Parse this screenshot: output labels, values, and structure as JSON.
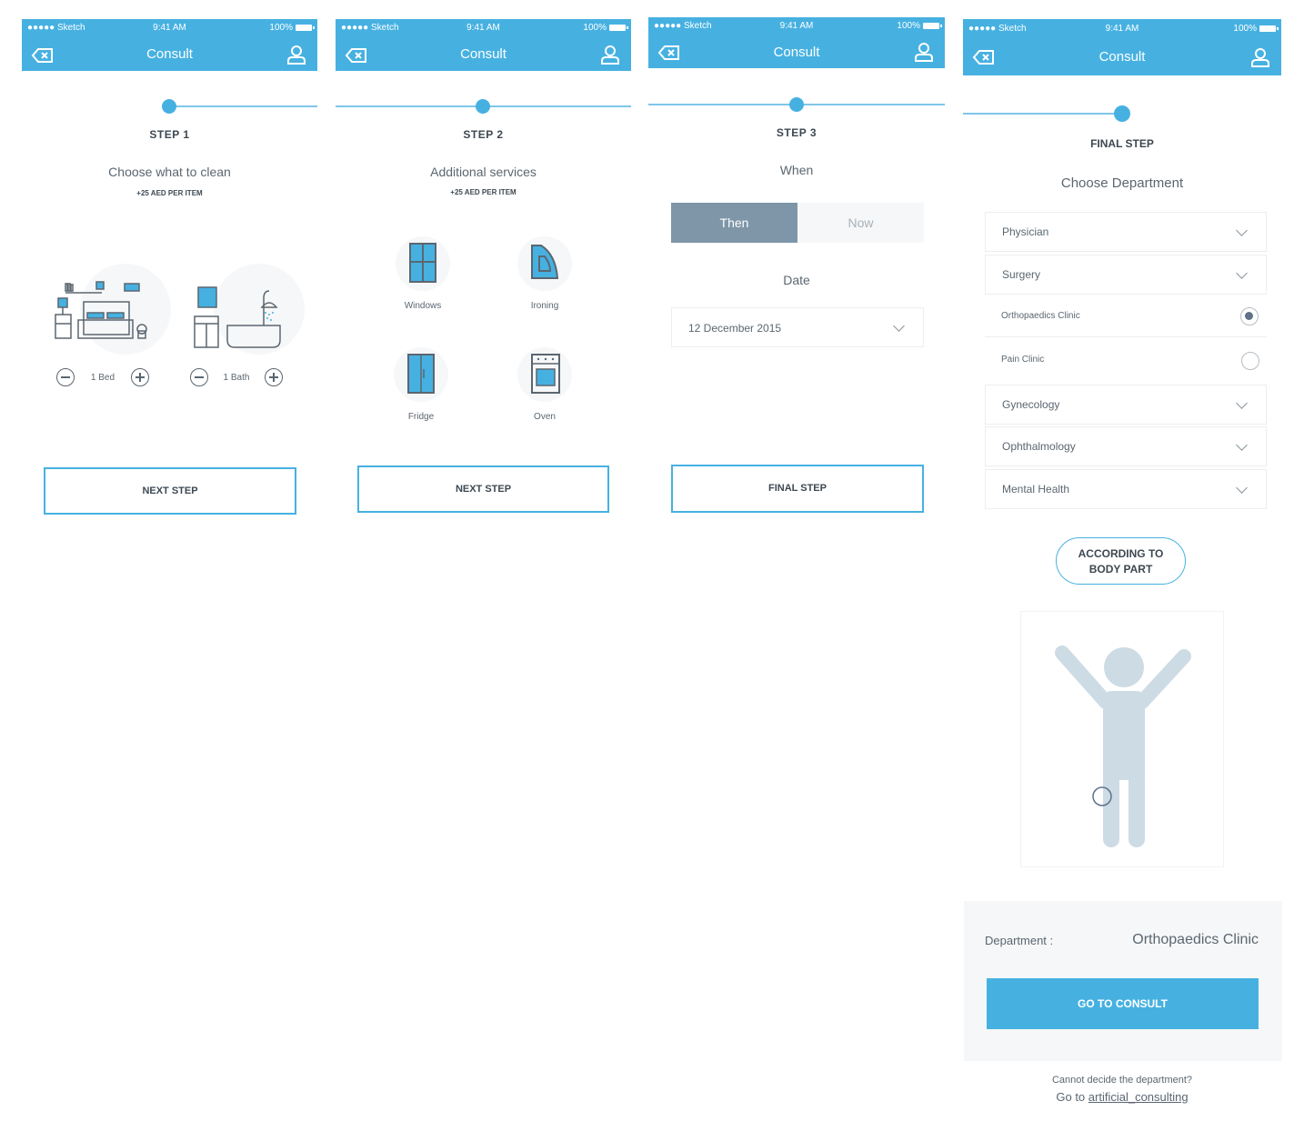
{
  "status_bar": {
    "carrier": "●●●●● Sketch",
    "time": "9:41 AM",
    "battery": "100%"
  },
  "nav": {
    "title": "Consult",
    "back_icon": "backspace-icon",
    "user_icon": "user-icon"
  },
  "colors": {
    "accent": "#46b1e1",
    "segment_active": "#7e96a8",
    "figure": "#cddbe5"
  },
  "screen1": {
    "step_label": "STEP 1",
    "heading": "Choose what to clean",
    "subnote": "+25 AED PER ITEM",
    "bed_count": "1 Bed",
    "bath_count": "1 Bath",
    "button": "NEXT STEP"
  },
  "screen2": {
    "step_label": "STEP 2",
    "heading": "Additional services",
    "subnote": "+25 AED PER ITEM",
    "services": [
      "Windows",
      "Ironing",
      "Fridge",
      "Oven"
    ],
    "button": "NEXT STEP"
  },
  "screen3": {
    "step_label": "STEP 3",
    "heading": "When",
    "segments": [
      "Then",
      "Now"
    ],
    "date_label": "Date",
    "date_value": "12 December 2015",
    "button": "FINAL STEP"
  },
  "screen4": {
    "step_label": "FINAL STEP",
    "heading": "Choose Department",
    "departments": [
      "Physician",
      "Surgery",
      "Orthopaedics Clinic",
      "Pain Clinic",
      "Gynecology",
      "Ophthalmology",
      "Mental Health"
    ],
    "pill_line1": "ACCORDING TO",
    "pill_line2": "BODY PART",
    "department_label": "Department :",
    "department_value": "Orthopaedics Clinic",
    "consult_button": "GO TO CONSULT",
    "help_text": "Cannot decide the department?",
    "help_prefix": "Go to ",
    "help_link": "artificial_consulting"
  }
}
